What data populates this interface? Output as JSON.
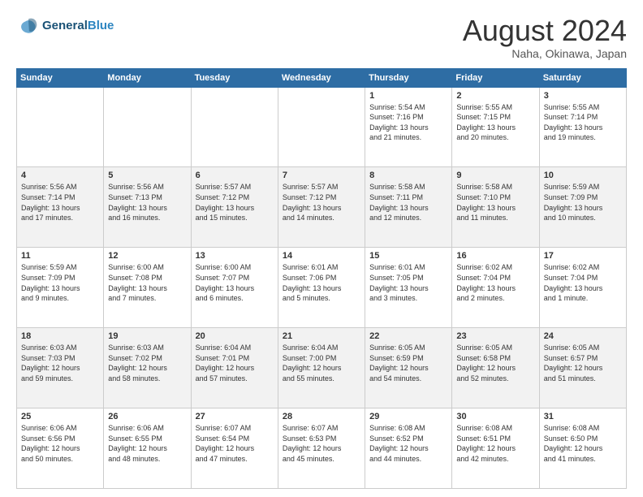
{
  "header": {
    "logo_line1": "General",
    "logo_line2": "Blue",
    "month_title": "August 2024",
    "location": "Naha, Okinawa, Japan"
  },
  "weekdays": [
    "Sunday",
    "Monday",
    "Tuesday",
    "Wednesday",
    "Thursday",
    "Friday",
    "Saturday"
  ],
  "weeks": [
    [
      {
        "day": "",
        "info": ""
      },
      {
        "day": "",
        "info": ""
      },
      {
        "day": "",
        "info": ""
      },
      {
        "day": "",
        "info": ""
      },
      {
        "day": "1",
        "info": "Sunrise: 5:54 AM\nSunset: 7:16 PM\nDaylight: 13 hours\nand 21 minutes."
      },
      {
        "day": "2",
        "info": "Sunrise: 5:55 AM\nSunset: 7:15 PM\nDaylight: 13 hours\nand 20 minutes."
      },
      {
        "day": "3",
        "info": "Sunrise: 5:55 AM\nSunset: 7:14 PM\nDaylight: 13 hours\nand 19 minutes."
      }
    ],
    [
      {
        "day": "4",
        "info": "Sunrise: 5:56 AM\nSunset: 7:14 PM\nDaylight: 13 hours\nand 17 minutes."
      },
      {
        "day": "5",
        "info": "Sunrise: 5:56 AM\nSunset: 7:13 PM\nDaylight: 13 hours\nand 16 minutes."
      },
      {
        "day": "6",
        "info": "Sunrise: 5:57 AM\nSunset: 7:12 PM\nDaylight: 13 hours\nand 15 minutes."
      },
      {
        "day": "7",
        "info": "Sunrise: 5:57 AM\nSunset: 7:12 PM\nDaylight: 13 hours\nand 14 minutes."
      },
      {
        "day": "8",
        "info": "Sunrise: 5:58 AM\nSunset: 7:11 PM\nDaylight: 13 hours\nand 12 minutes."
      },
      {
        "day": "9",
        "info": "Sunrise: 5:58 AM\nSunset: 7:10 PM\nDaylight: 13 hours\nand 11 minutes."
      },
      {
        "day": "10",
        "info": "Sunrise: 5:59 AM\nSunset: 7:09 PM\nDaylight: 13 hours\nand 10 minutes."
      }
    ],
    [
      {
        "day": "11",
        "info": "Sunrise: 5:59 AM\nSunset: 7:09 PM\nDaylight: 13 hours\nand 9 minutes."
      },
      {
        "day": "12",
        "info": "Sunrise: 6:00 AM\nSunset: 7:08 PM\nDaylight: 13 hours\nand 7 minutes."
      },
      {
        "day": "13",
        "info": "Sunrise: 6:00 AM\nSunset: 7:07 PM\nDaylight: 13 hours\nand 6 minutes."
      },
      {
        "day": "14",
        "info": "Sunrise: 6:01 AM\nSunset: 7:06 PM\nDaylight: 13 hours\nand 5 minutes."
      },
      {
        "day": "15",
        "info": "Sunrise: 6:01 AM\nSunset: 7:05 PM\nDaylight: 13 hours\nand 3 minutes."
      },
      {
        "day": "16",
        "info": "Sunrise: 6:02 AM\nSunset: 7:04 PM\nDaylight: 13 hours\nand 2 minutes."
      },
      {
        "day": "17",
        "info": "Sunrise: 6:02 AM\nSunset: 7:04 PM\nDaylight: 13 hours\nand 1 minute."
      }
    ],
    [
      {
        "day": "18",
        "info": "Sunrise: 6:03 AM\nSunset: 7:03 PM\nDaylight: 12 hours\nand 59 minutes."
      },
      {
        "day": "19",
        "info": "Sunrise: 6:03 AM\nSunset: 7:02 PM\nDaylight: 12 hours\nand 58 minutes."
      },
      {
        "day": "20",
        "info": "Sunrise: 6:04 AM\nSunset: 7:01 PM\nDaylight: 12 hours\nand 57 minutes."
      },
      {
        "day": "21",
        "info": "Sunrise: 6:04 AM\nSunset: 7:00 PM\nDaylight: 12 hours\nand 55 minutes."
      },
      {
        "day": "22",
        "info": "Sunrise: 6:05 AM\nSunset: 6:59 PM\nDaylight: 12 hours\nand 54 minutes."
      },
      {
        "day": "23",
        "info": "Sunrise: 6:05 AM\nSunset: 6:58 PM\nDaylight: 12 hours\nand 52 minutes."
      },
      {
        "day": "24",
        "info": "Sunrise: 6:05 AM\nSunset: 6:57 PM\nDaylight: 12 hours\nand 51 minutes."
      }
    ],
    [
      {
        "day": "25",
        "info": "Sunrise: 6:06 AM\nSunset: 6:56 PM\nDaylight: 12 hours\nand 50 minutes."
      },
      {
        "day": "26",
        "info": "Sunrise: 6:06 AM\nSunset: 6:55 PM\nDaylight: 12 hours\nand 48 minutes."
      },
      {
        "day": "27",
        "info": "Sunrise: 6:07 AM\nSunset: 6:54 PM\nDaylight: 12 hours\nand 47 minutes."
      },
      {
        "day": "28",
        "info": "Sunrise: 6:07 AM\nSunset: 6:53 PM\nDaylight: 12 hours\nand 45 minutes."
      },
      {
        "day": "29",
        "info": "Sunrise: 6:08 AM\nSunset: 6:52 PM\nDaylight: 12 hours\nand 44 minutes."
      },
      {
        "day": "30",
        "info": "Sunrise: 6:08 AM\nSunset: 6:51 PM\nDaylight: 12 hours\nand 42 minutes."
      },
      {
        "day": "31",
        "info": "Sunrise: 6:08 AM\nSunset: 6:50 PM\nDaylight: 12 hours\nand 41 minutes."
      }
    ]
  ]
}
